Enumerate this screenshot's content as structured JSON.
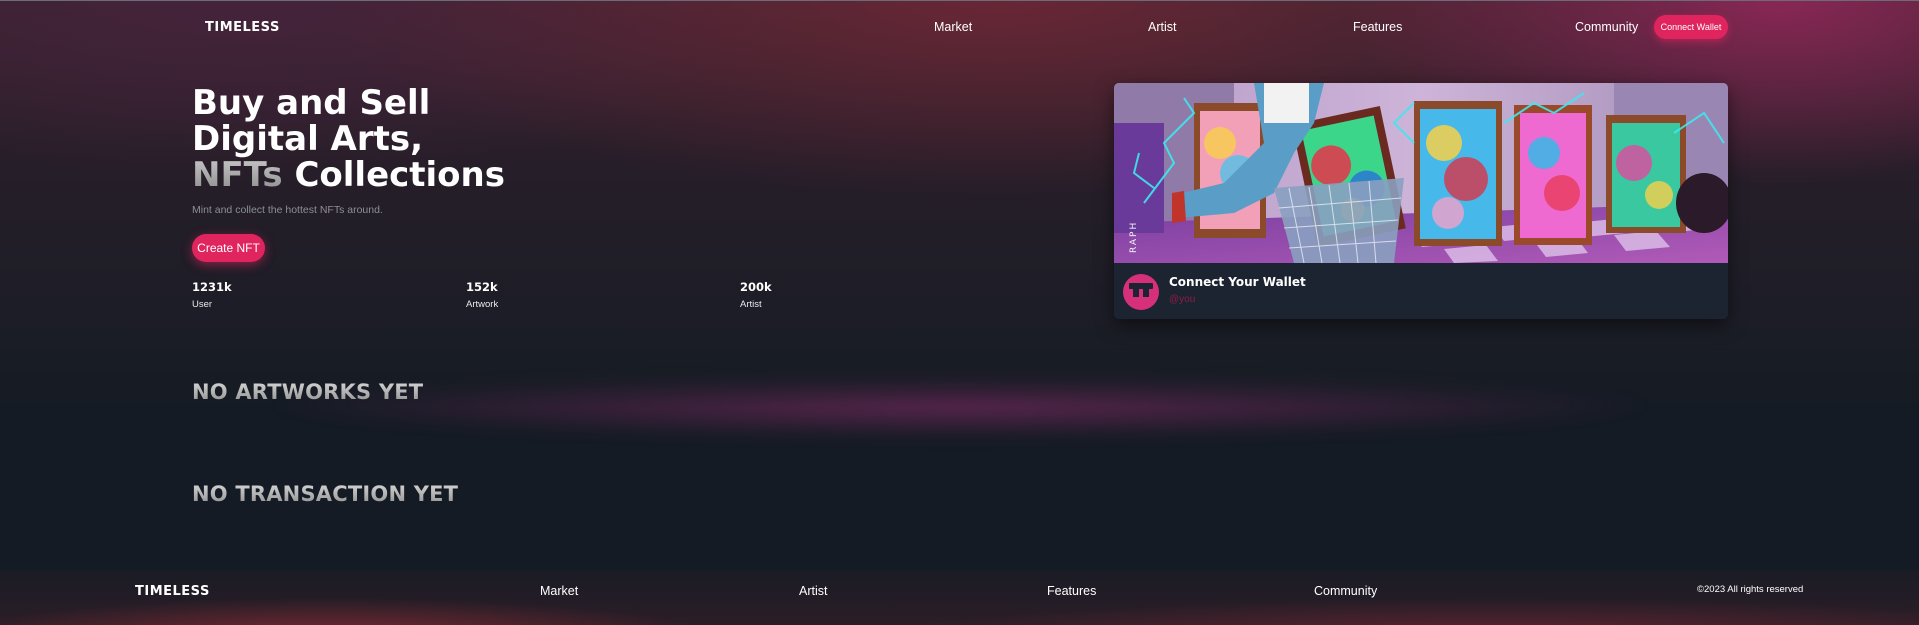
{
  "header": {
    "logo": "TIMELESS",
    "nav": [
      "Market",
      "Artist",
      "Features",
      "Community"
    ],
    "connect_label": "Connect Wallet"
  },
  "hero": {
    "title_line1": "Buy and Sell",
    "title_line2": "Digital Arts,",
    "title_muted": "NFTs",
    "title_line3_rest": " Collections",
    "subtitle": "Mint and collect the hottest NFTs around.",
    "create_label": "Create NFT",
    "stats": [
      {
        "value": "1231k",
        "label": "User"
      },
      {
        "value": "152k",
        "label": "Artwork"
      },
      {
        "value": "200k",
        "label": "Artist"
      }
    ]
  },
  "card": {
    "art_signature": "RAPH",
    "name": "Connect Your Wallet",
    "handle": "@you"
  },
  "sections": {
    "artworks_empty": "NO ARTWORKS YET",
    "transactions_empty": "NO TRANSACTION YET"
  },
  "footer": {
    "logo": "TIMELESS",
    "nav": [
      "Market",
      "Artist",
      "Features",
      "Community"
    ],
    "copyright": "©2023 All rights reserved"
  },
  "colors": {
    "accent": "#e0245e",
    "background": "#151c25",
    "card": "#1d2431",
    "handle": "#8a1d45"
  }
}
